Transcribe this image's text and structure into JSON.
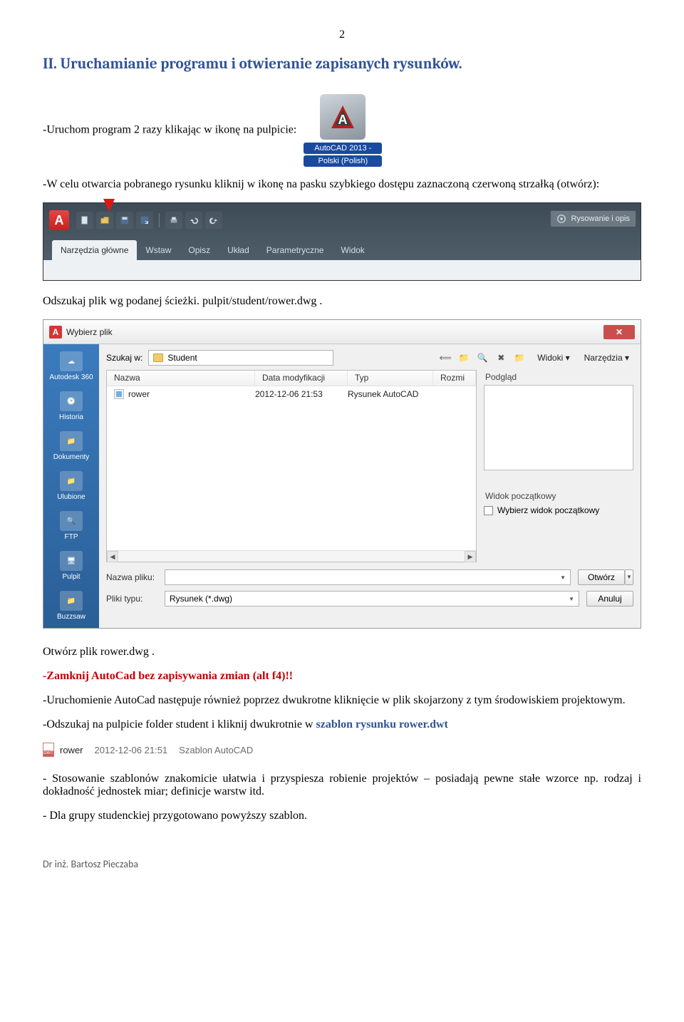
{
  "page_number": "2",
  "title": "II. Uruchamianie programu i otwieranie zapisanych rysunków.",
  "p_launch": "-Uruchom program 2 razy klikając w ikonę na pulpicie:",
  "desktop_icon": {
    "caption1": "AutoCAD 2013 -",
    "caption2": "Polski (Polish)"
  },
  "p_open": "-W celu otwarcia pobranego rysunku kliknij w ikonę na pasku szybkiego dostępu zaznaczoną czerwoną strzałką (otwórz):",
  "ribbon": {
    "drawing_chip": "Rysowanie i opis",
    "tabs": [
      "Narzędzia główne",
      "Wstaw",
      "Opisz",
      "Układ",
      "Parametryczne",
      "Widok"
    ]
  },
  "p_path": "Odszukaj plik wg podanej ścieżki. pulpit/student/rower.dwg .",
  "dialog": {
    "title": "Wybierz plik",
    "lookin_label": "Szukaj w:",
    "lookin_value": "Student",
    "views": "Widoki",
    "tools": "Narzędzia",
    "columns": {
      "name": "Nazwa",
      "date": "Data modyfikacji",
      "type": "Typ",
      "size": "Rozmi"
    },
    "rows": [
      {
        "name": "rower",
        "date": "2012-12-06 21:53",
        "type": "Rysunek AutoCAD"
      }
    ],
    "preview_label": "Podgląd",
    "startview_label": "Widok początkowy",
    "startview_check": "Wybierz widok początkowy",
    "filename_label": "Nazwa pliku:",
    "filename_value": "",
    "filetype_label": "Pliki typu:",
    "filetype_value": "Rysunek (*.dwg)",
    "open_btn": "Otwórz",
    "cancel_btn": "Anuluj",
    "places": [
      "Autodesk 360",
      "Historia",
      "Dokumenty",
      "Ulubione",
      "FTP",
      "Pulpit",
      "Buzzsaw"
    ]
  },
  "p_open_file": "Otwórz plik rower.dwg .",
  "p_close_acad": "-Zamknij AutoCad bez zapisywania zmian (alt f4)!!",
  "p_dblclick": "-Uruchomienie AutoCad następuje również poprzez dwukrotne kliknięcie w plik skojarzony z tym środowiskiem projektowym.",
  "p_template_pre": "-Odszukaj na pulpicie folder student i kliknij dwukrotnie w ",
  "p_template_link": "szablon rysunku rower.dwt",
  "template_row": {
    "name": "rower",
    "date": "2012-12-06 21:51",
    "type": "Szablon AutoCAD"
  },
  "p_templates": "- Stosowanie szablonów znakomicie ułatwia i przyspiesza robienie projektów – posiadają pewne stałe wzorce np. rodzaj i dokładność jednostek miar; definicje warstw itd.",
  "p_group": "- Dla grupy studenckiej przygotowano powyższy szablon.",
  "footer": "Dr inż. Bartosz Pieczaba"
}
